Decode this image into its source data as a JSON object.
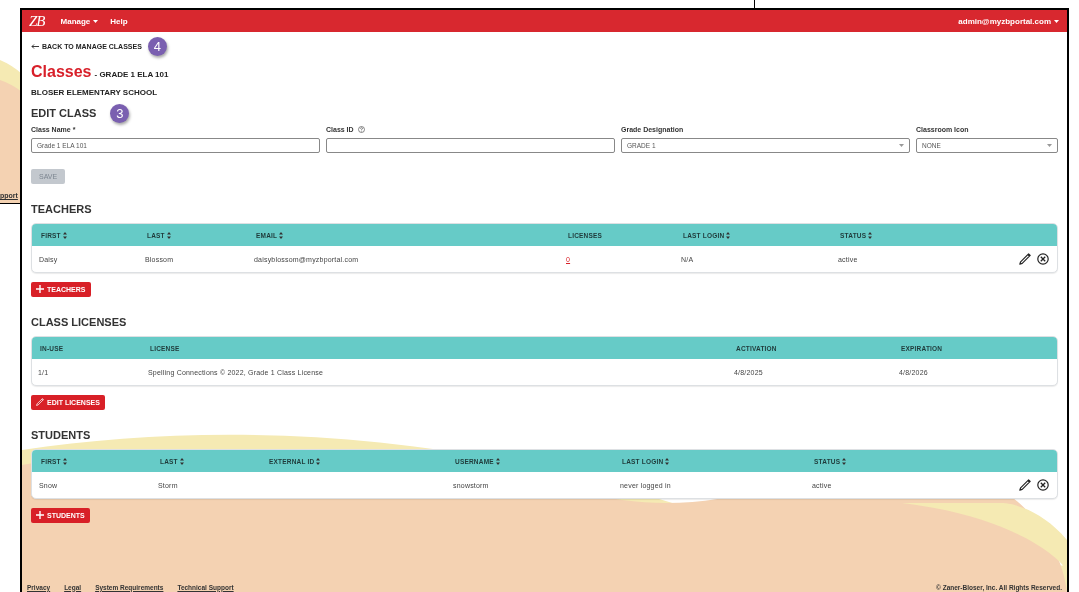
{
  "back_window": {
    "link": "pport"
  },
  "header": {
    "logo": "ZB",
    "menu": [
      {
        "label": "Manage",
        "dropdown": true
      },
      {
        "label": "Help",
        "dropdown": false
      }
    ],
    "user": {
      "label": "admin@myzbportal.com",
      "dropdown": true
    }
  },
  "back_link": {
    "label": "BACK TO MANAGE CLASSES",
    "badge": "4"
  },
  "title": "Classes",
  "subtitle": "- GRADE 1 ELA 101",
  "school": "BLOSER ELEMENTARY SCHOOL",
  "edit": {
    "heading": "EDIT CLASS",
    "badge": "3"
  },
  "fields": [
    {
      "kind": "text",
      "label": "Class Name *",
      "help": false,
      "value": "Grade 1 ELA 101"
    },
    {
      "kind": "text",
      "label": "Class ID",
      "help": true
    },
    {
      "kind": "select",
      "label": "Grade Designation",
      "help": false,
      "value": "GRADE 1"
    },
    {
      "kind": "select",
      "label": "Classroom Icon",
      "help": false,
      "value": "NONE"
    }
  ],
  "save": {
    "label": "SAVE",
    "disabled": true
  },
  "sections": [
    {
      "heading": "TEACHERS",
      "columns": [
        {
          "label": "FIRST",
          "sortable": true,
          "kind": "text"
        },
        {
          "label": "LAST",
          "sortable": true,
          "kind": "text"
        },
        {
          "label": "EMAIL",
          "sortable": true,
          "kind": "text"
        },
        {
          "label": "LICENSES",
          "sortable": false,
          "kind": "link"
        },
        {
          "label": "LAST LOGIN",
          "sortable": true,
          "kind": "text"
        },
        {
          "label": "STATUS",
          "sortable": true,
          "kind": "text"
        }
      ],
      "rows": [
        {
          "cells": [
            "Daisy",
            "Blossom",
            "daisyblossom@myzbportal.com",
            "0",
            "N/A",
            "active"
          ],
          "actions": true
        }
      ],
      "button": {
        "kind": "add",
        "label": "TEACHERS"
      }
    },
    {
      "heading": "CLASS LICENSES",
      "columns": [
        {
          "label": "IN-USE",
          "sortable": false,
          "kind": "text"
        },
        {
          "label": "LICENSE",
          "sortable": false,
          "kind": "text"
        },
        {
          "label": "ACTIVATION",
          "sortable": false,
          "kind": "text"
        },
        {
          "label": "EXPIRATION",
          "sortable": false,
          "kind": "text"
        }
      ],
      "rows": [
        {
          "cells": [
            "1/1",
            "Spelling Connections © 2022, Grade 1 Class License",
            "4/8/2025",
            "4/8/2026"
          ],
          "actions": false
        }
      ],
      "button": {
        "kind": "edit",
        "label": "EDIT LICENSES"
      }
    },
    {
      "heading": "STUDENTS",
      "columns": [
        {
          "label": "FIRST",
          "sortable": true,
          "kind": "text"
        },
        {
          "label": "LAST",
          "sortable": true,
          "kind": "text"
        },
        {
          "label": "EXTERNAL ID",
          "sortable": true,
          "kind": "text"
        },
        {
          "label": "USERNAME",
          "sortable": true,
          "kind": "text"
        },
        {
          "label": "LAST LOGIN",
          "sortable": true,
          "kind": "text"
        },
        {
          "label": "STATUS",
          "sortable": true,
          "kind": "text"
        }
      ],
      "rows": [
        {
          "cells": [
            "Snow",
            "Storm",
            null,
            "snowstorm",
            "never logged in",
            "active"
          ],
          "actions": true
        }
      ],
      "button": {
        "kind": "add",
        "label": "STUDENTS"
      }
    }
  ],
  "footer": {
    "links": [
      "Privacy",
      "Legal",
      "System Requirements",
      "Technical Support"
    ],
    "copyright": "© Zaner-Bloser, Inc. All Rights Reserved."
  }
}
